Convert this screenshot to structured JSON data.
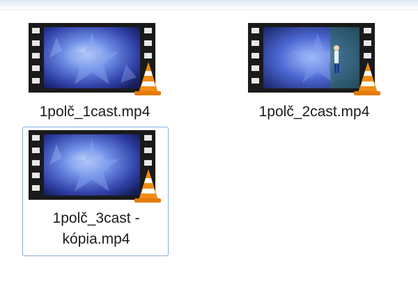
{
  "files": [
    {
      "name": "1polč_1cast.mp4",
      "name_line2": ""
    },
    {
      "name": "1polč_2cast.mp4",
      "name_line2": ""
    },
    {
      "name": "1polč_3cast -",
      "name_line2": "kópia.mp4"
    }
  ],
  "selected_index": 2,
  "icon_overlay": "vlc-cone-icon",
  "colors": {
    "film_strip": "#1a1a1a",
    "film_hole": "#e8e8e8",
    "frame_blue": "#3d56c6",
    "selection_border": "#84acdd",
    "vlc_orange": "#f28c13"
  }
}
